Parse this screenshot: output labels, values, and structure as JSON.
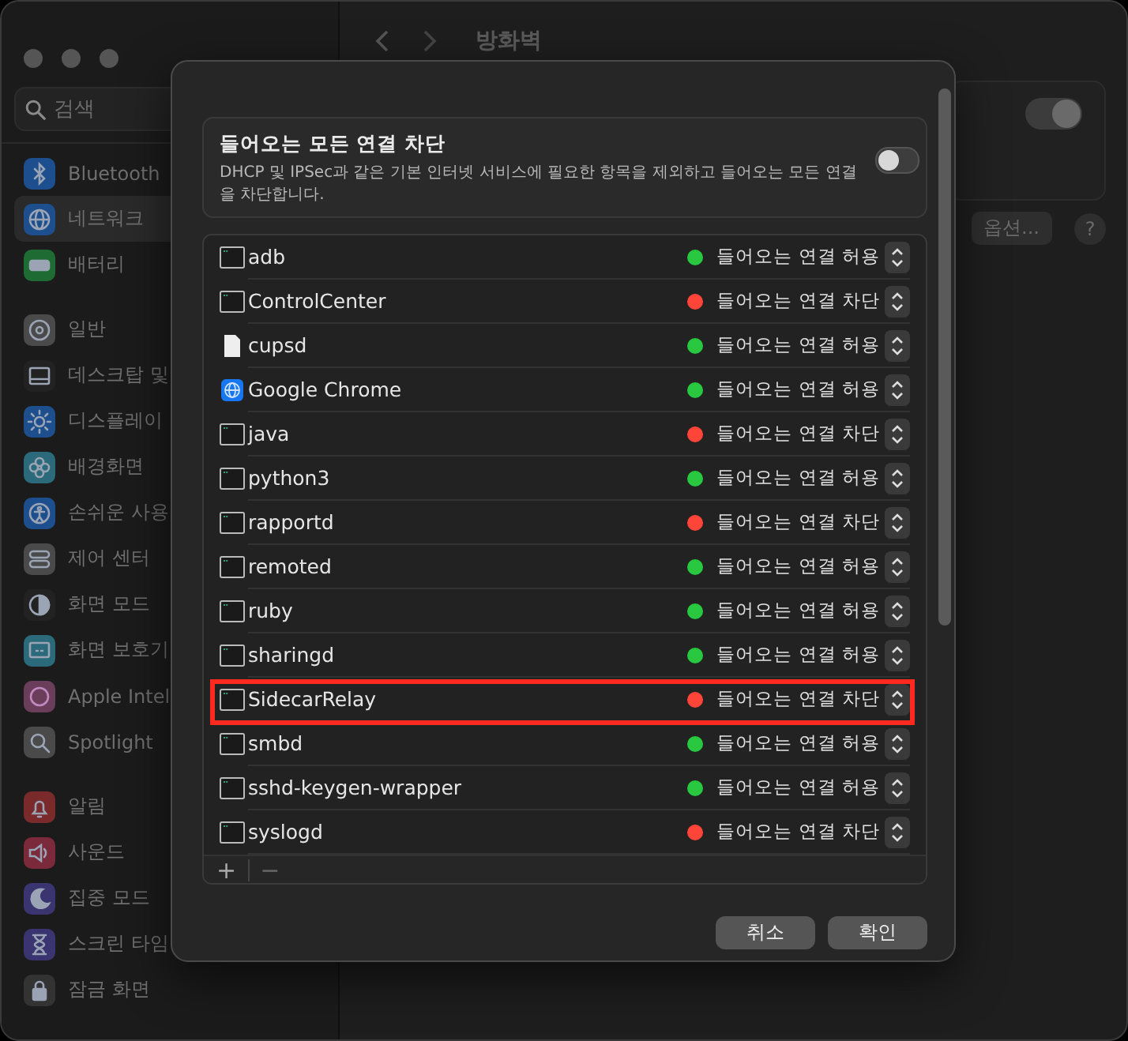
{
  "window": {
    "title": "방화벽",
    "search": {
      "placeholder": "검색"
    }
  },
  "sidebar": {
    "groups": [
      {
        "items": [
          {
            "label": "Bluetooth",
            "kind": "bluetooth",
            "selected": false
          },
          {
            "label": "네트워크",
            "kind": "network",
            "selected": true
          },
          {
            "label": "배터리",
            "kind": "battery",
            "selected": false
          }
        ]
      },
      {
        "items": [
          {
            "label": "일반",
            "kind": "general",
            "selected": false
          },
          {
            "label": "데스크탑 및",
            "kind": "desktop",
            "selected": false
          },
          {
            "label": "디스플레이",
            "kind": "display",
            "selected": false
          },
          {
            "label": "배경화면",
            "kind": "wallpaper",
            "selected": false
          },
          {
            "label": "손쉬운 사용",
            "kind": "accessibility",
            "selected": false
          },
          {
            "label": "제어 센터",
            "kind": "control",
            "selected": false
          },
          {
            "label": "화면 모드",
            "kind": "appearance",
            "selected": false
          },
          {
            "label": "화면 보호기",
            "kind": "screensaver",
            "selected": false
          },
          {
            "label": "Apple Intel",
            "kind": "intelligence",
            "selected": false
          },
          {
            "label": "Spotlight",
            "kind": "spotlight",
            "selected": false
          }
        ]
      },
      {
        "items": [
          {
            "label": "알림",
            "kind": "notifications",
            "selected": false
          },
          {
            "label": "사운드",
            "kind": "sound",
            "selected": false
          },
          {
            "label": "집중 모드",
            "kind": "focus",
            "selected": false
          },
          {
            "label": "스크린 타임",
            "kind": "screentime",
            "selected": false
          },
          {
            "label": "잠금 화면",
            "kind": "lock",
            "selected": false
          }
        ]
      }
    ]
  },
  "main": {
    "firewall_on": true,
    "options_button": "옵션...",
    "help_button": "?"
  },
  "dialog": {
    "block_all": {
      "title": "들어오는 모든 연결 차단",
      "description": "DHCP 및 IPSec과 같은 기본 인터넷 서비스에 필요한 항목을 제외하고 들어오는 모든 연결을 차단합니다.",
      "on": false
    },
    "apps": [
      {
        "name": "adb",
        "kind": "terminal",
        "color": "#28c840",
        "status": "들어오는 연결 허용",
        "highlighted": false
      },
      {
        "name": "ControlCenter",
        "kind": "terminal",
        "color": "#ff453a",
        "status": "들어오는 연결 차단",
        "highlighted": false
      },
      {
        "name": "cupsd",
        "kind": "document",
        "color": "#28c840",
        "status": "들어오는 연결 허용",
        "highlighted": false
      },
      {
        "name": "Google Chrome",
        "kind": "globe",
        "color": "#28c840",
        "status": "들어오는 연결 허용",
        "highlighted": false
      },
      {
        "name": "java",
        "kind": "terminal",
        "color": "#ff453a",
        "status": "들어오는 연결 차단",
        "highlighted": false
      },
      {
        "name": "python3",
        "kind": "terminal",
        "color": "#28c840",
        "status": "들어오는 연결 허용",
        "highlighted": false
      },
      {
        "name": "rapportd",
        "kind": "terminal",
        "color": "#ff453a",
        "status": "들어오는 연결 차단",
        "highlighted": false
      },
      {
        "name": "remoted",
        "kind": "terminal",
        "color": "#28c840",
        "status": "들어오는 연결 허용",
        "highlighted": false
      },
      {
        "name": "ruby",
        "kind": "terminal",
        "color": "#28c840",
        "status": "들어오는 연결 허용",
        "highlighted": false
      },
      {
        "name": "sharingd",
        "kind": "terminal",
        "color": "#28c840",
        "status": "들어오는 연결 허용",
        "highlighted": false
      },
      {
        "name": "SidecarRelay",
        "kind": "terminal",
        "color": "#ff453a",
        "status": "들어오는 연결 차단",
        "highlighted": true
      },
      {
        "name": "smbd",
        "kind": "terminal",
        "color": "#28c840",
        "status": "들어오는 연결 허용",
        "highlighted": false
      },
      {
        "name": "sshd-keygen-wrapper",
        "kind": "terminal",
        "color": "#28c840",
        "status": "들어오는 연결 허용",
        "highlighted": false
      },
      {
        "name": "syslogd",
        "kind": "terminal",
        "color": "#ff453a",
        "status": "들어오는 연결 차단",
        "highlighted": false
      }
    ],
    "add_button": "+",
    "remove_button": "−",
    "buttons": [
      {
        "label": "취소"
      },
      {
        "label": "확인"
      }
    ]
  }
}
